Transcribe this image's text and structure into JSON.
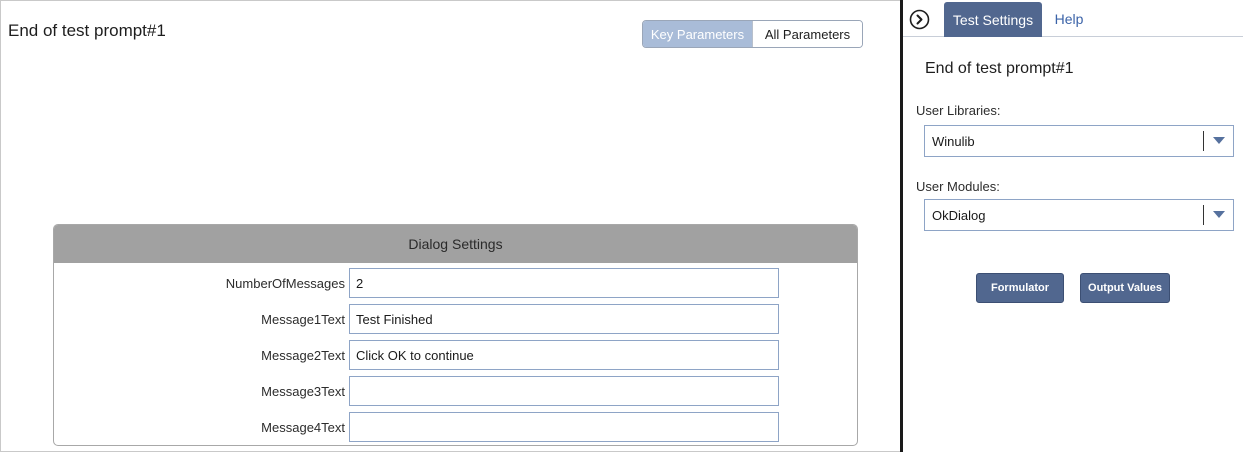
{
  "main": {
    "title": "End of test prompt#1",
    "view_toggle": {
      "key_parameters": "Key Parameters",
      "all_parameters": "All Parameters",
      "selected": "Key Parameters"
    },
    "dialog": {
      "header": "Dialog Settings",
      "fields": [
        {
          "label": "NumberOfMessages",
          "value": "2"
        },
        {
          "label": "Message1Text",
          "value": "Test Finished"
        },
        {
          "label": "Message2Text",
          "value": "Click OK to continue"
        },
        {
          "label": "Message3Text",
          "value": ""
        },
        {
          "label": "Message4Text",
          "value": ""
        }
      ]
    }
  },
  "sidebar": {
    "collapse_icon": "chevron-right-circle-icon",
    "tabs": [
      {
        "label": "Test Settings",
        "active": true
      },
      {
        "label": "Help",
        "active": false
      }
    ],
    "title": "End of test prompt#1",
    "user_libraries": {
      "label": "User Libraries:",
      "value": "Winulib"
    },
    "user_modules": {
      "label": "User Modules:",
      "value": "OkDialog"
    },
    "buttons": {
      "formulator": "Formulator",
      "output_values": "Output Values"
    }
  },
  "colors": {
    "accent": "#51678f",
    "toggle_active": "#a9bcd8",
    "dialog_header": "#a1a1a1",
    "input_border": "#8ea4c6",
    "link": "#3b63a8"
  }
}
